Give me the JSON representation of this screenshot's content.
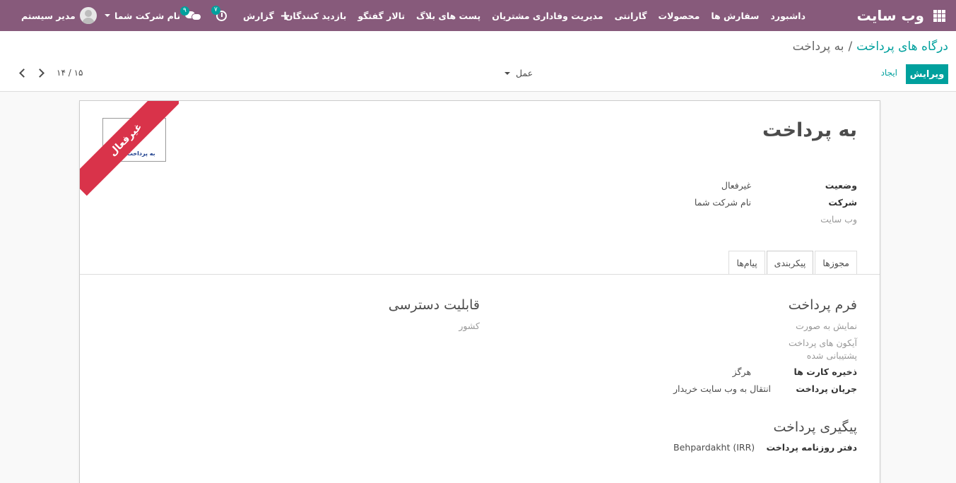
{
  "navbar": {
    "brand": "وب سایت",
    "menu": [
      "داشبورد",
      "سفارش ها",
      "محصولات",
      "گارانتی",
      "مدیریت وفاداری مشتریان",
      "پست های بلاگ",
      "تالار گفتگو",
      "بازدید کنندگان",
      "گزارش"
    ],
    "activity_count": "۷",
    "messages_count": "۹",
    "company": "نام شرکت شما",
    "user": "مدیر سیستم"
  },
  "control_panel": {
    "breadcrumb_parent": "درگاه های پرداخت",
    "breadcrumb_separator": "/",
    "breadcrumb_current": "به پرداخت",
    "edit_label": "ویرایش",
    "create_label": "ایجاد",
    "action_label": "عمل",
    "pager": "۱۴ / ۱۵"
  },
  "form": {
    "title": "به پرداخت",
    "ribbon": "غیرفعال",
    "logo_text": "به پرداخت ملت",
    "fields": {
      "state_label": "وضعیت",
      "state_value": "غیرفعال",
      "company_label": "شرکت",
      "company_value": "نام شرکت شما",
      "website_label": "وب سایت"
    },
    "tabs": [
      "مجوزها",
      "پیکربندی",
      "پیام‌ها"
    ],
    "active_tab": "پیکربندی",
    "payment_form": {
      "title": "فرم پرداخت",
      "display_as": "نمایش به صورت",
      "supported_icons_1": "آیکون های پرداخت",
      "supported_icons_2": "پشتیبانی شده",
      "save_cards_label": "ذخیره کارت ها",
      "save_cards_value": "هرگز",
      "payment_flow_label": "جریان پرداخت",
      "payment_flow_value": "انتقال به وب سایت خریدار"
    },
    "availability": {
      "title": "قابلیت دسترسی",
      "country_label": "کشور"
    },
    "followup": {
      "title": "پیگیری پرداخت",
      "journal_label": "دفتر روزنامه پرداخت",
      "journal_value": "Behpardakht (IRR)"
    }
  }
}
